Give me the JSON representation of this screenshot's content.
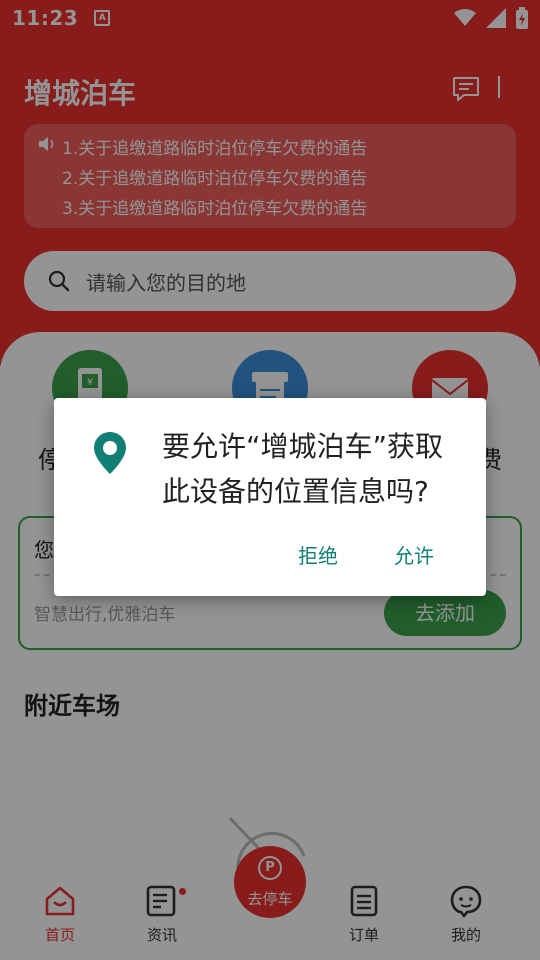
{
  "status_bar": {
    "time": "11:23",
    "notification": "A"
  },
  "header": {
    "title": "增城泊车",
    "notices": [
      "1.关于追缴道路临时泊位停车欠费的通告",
      "2.关于追缴道路临时泊位停车欠费的通告",
      "3.关于追缴道路临时泊位停车欠费的通告"
    ]
  },
  "search": {
    "placeholder": "请输入您的目的地"
  },
  "features": [
    {
      "label": "停",
      "icon": "parking-fee-icon",
      "color": "#3aa34a"
    },
    {
      "label": "",
      "icon": "invoice-icon",
      "color": "#3b8fd9"
    },
    {
      "label": "费",
      "icon": "envelope-icon",
      "color": "#e8312f"
    }
  ],
  "plate_card": {
    "title": "您",
    "subtitle": "智慧出行,优雅泊车",
    "add_button": "去添加"
  },
  "nearby": {
    "title": "附近车场"
  },
  "bottom_nav": {
    "home": "首页",
    "news": "资讯",
    "center": "去停车",
    "order": "订单",
    "mine": "我的"
  },
  "dialog": {
    "message": "要允许“增城泊车”获取此设备的位置信息吗?",
    "deny": "拒绝",
    "allow": "允许"
  },
  "colors": {
    "brand_red": "#e8312f",
    "green": "#3aa34a",
    "teal": "#117f74"
  }
}
